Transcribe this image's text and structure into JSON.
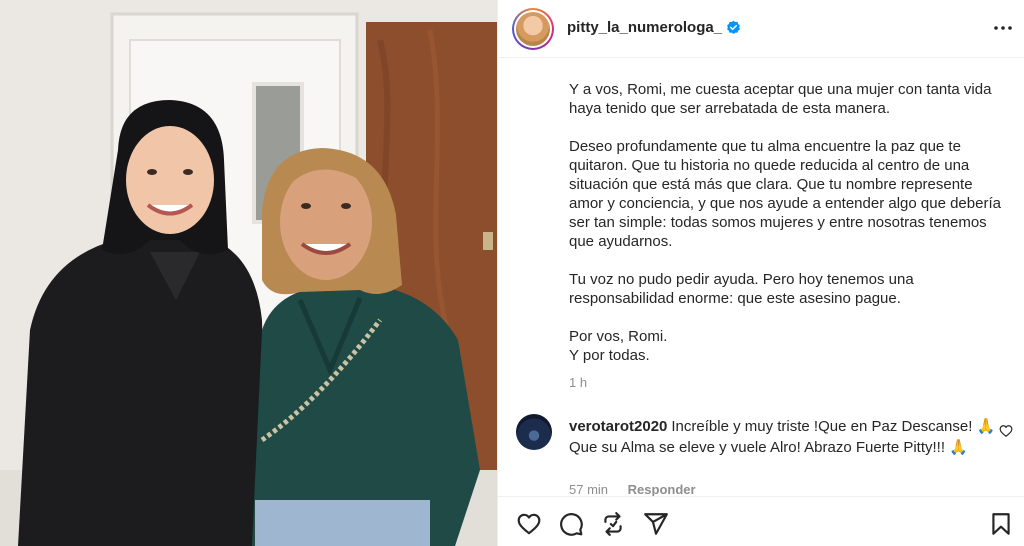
{
  "photo": {
    "description_icon": "photo-two-women"
  },
  "post": {
    "username": "pitty_la_numerologa_",
    "verified_icon": "verified-badge-icon",
    "more_icon": "more-options-icon",
    "caption_paragraphs": [
      "Y a vos, Romi, me cuesta aceptar que una mujer con tanta vida haya tenido que ser arrebatada de esta manera.",
      "Deseo profundamente que tu alma encuentre la paz que te quitaron. Que tu historia no quede reducida al centro de una situación que está más que clara. Que tu nombre represente amor y conciencia, y que nos ayude a entender algo que debería ser tan simple: todas somos mujeres y entre nosotras tenemos que ayudarnos.",
      "Tu voz no pudo pedir ayuda. Pero hoy tenemos una responsabilidad enorme: que este asesino pague.",
      "Por vos, Romi.\nY por todas."
    ],
    "time": "1 h"
  },
  "comment": {
    "username": "verotarot2020",
    "text": "Increíble y muy triste !Que en Paz Descanse! 🙏 Que su Alma se eleve y vuele Alro! Abrazo Fuerte Pitty!!! 🙏",
    "time": "57 min",
    "reply_label": "Responder"
  },
  "actions": {
    "like_icon": "heart-icon",
    "comment_icon": "comment-icon",
    "repost_icon": "repost-icon",
    "share_icon": "share-icon",
    "save_icon": "bookmark-icon"
  },
  "colors": {
    "verified": "#0095f6",
    "secondary_text": "#8e8e8e",
    "primary_text": "#262626"
  }
}
